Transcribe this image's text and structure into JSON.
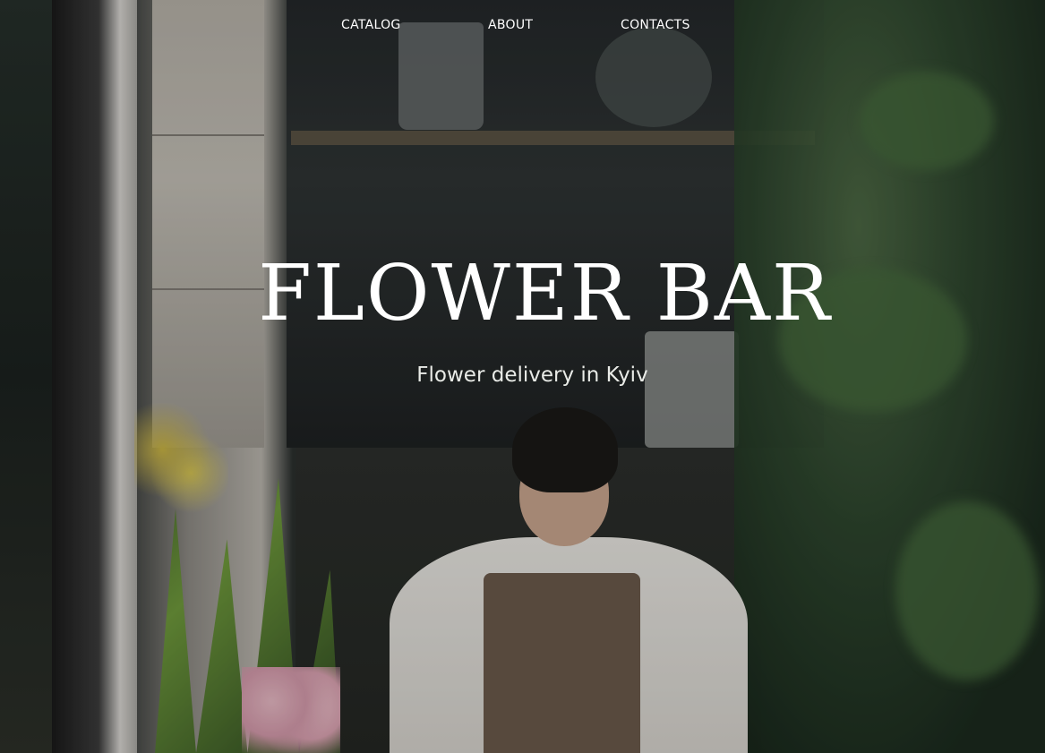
{
  "nav": {
    "items": [
      {
        "label": "CATALOG"
      },
      {
        "label": "ABOUT"
      },
      {
        "label": "CONTACTS"
      }
    ]
  },
  "hero": {
    "title": "FLOWER BAR",
    "subtitle": "Flower delivery in Kyiv"
  },
  "colors": {
    "text": "#ffffff",
    "background_dark": "#1e2622"
  }
}
